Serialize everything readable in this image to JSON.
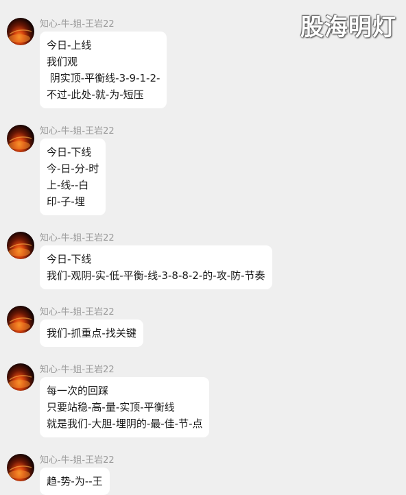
{
  "watermark": "股海明灯",
  "messages": [
    {
      "sender": "知心-牛-姐-王岩22",
      "lines": [
        "今日-上线",
        "我们观",
        " 阴实顶-平衡线-3-9-1-2-",
        "不过-此处-就-为-短压"
      ]
    },
    {
      "sender": "知心-牛-姐-王岩22",
      "lines": [
        "今日-下线",
        "今-日-分-时",
        "上-线--白",
        "印-子-埋"
      ]
    },
    {
      "sender": "知心-牛-姐-王岩22",
      "lines": [
        "今日-下线",
        "我们-观阴-实-低-平衡-线-3-8-8-2-的-攻-防-节奏"
      ]
    },
    {
      "sender": "知心-牛-姐-王岩22",
      "lines": [
        "我们-抓重点-找关键"
      ]
    },
    {
      "sender": "知心-牛-姐-王岩22",
      "lines": [
        "每一次的回踩",
        "只要站稳-高-量-实顶-平衡线",
        "就是我们-大胆-埋阴的-最-佳-节-点"
      ]
    },
    {
      "sender": "知心-牛-姐-王岩22",
      "lines": [
        "趋-势-为--王"
      ]
    }
  ]
}
